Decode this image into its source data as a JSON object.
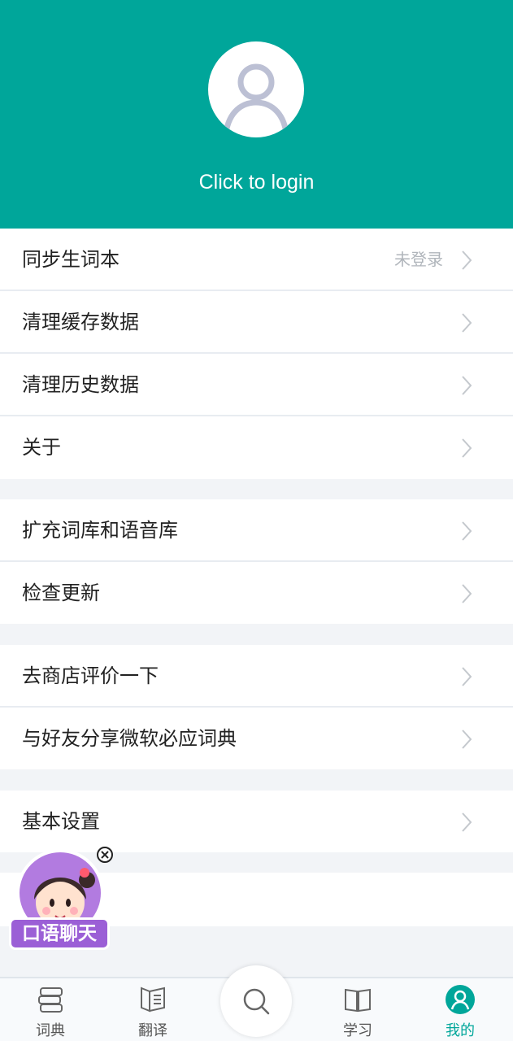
{
  "header": {
    "login_text": "Click to login"
  },
  "sections": {
    "s1": [
      {
        "label": "同步生词本",
        "value": "未登录"
      },
      {
        "label": "清理缓存数据"
      },
      {
        "label": "清理历史数据"
      },
      {
        "label": "关于"
      }
    ],
    "s2": [
      {
        "label": "扩充词库和语音库"
      },
      {
        "label": "检查更新"
      }
    ],
    "s3": [
      {
        "label": "去商店评价一下"
      },
      {
        "label": "与好友分享微软必应词典"
      }
    ],
    "s4": [
      {
        "label": "基本设置"
      }
    ]
  },
  "chat_widget": {
    "label": "口语聊天"
  },
  "bottom_nav": {
    "items": [
      {
        "label": "词典",
        "icon": "dictionary-icon"
      },
      {
        "label": "翻译",
        "icon": "translate-icon"
      },
      {
        "label": "学习",
        "icon": "book-icon"
      },
      {
        "label": "我的",
        "icon": "profile-icon",
        "active": true
      }
    ]
  },
  "colors": {
    "accent": "#00a69a",
    "chat_purple": "#9b5fd6"
  }
}
